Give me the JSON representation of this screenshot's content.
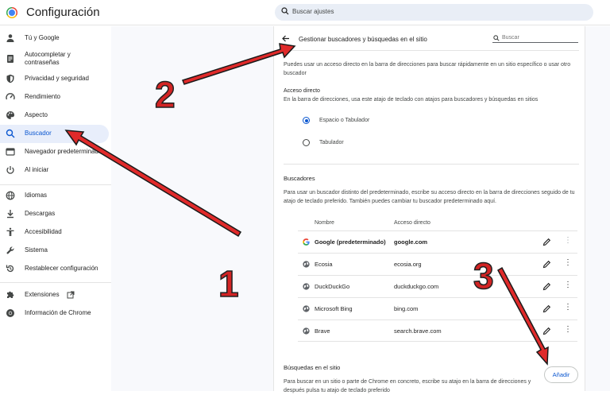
{
  "app": {
    "title": "Configuración",
    "search_placeholder": "Buscar ajustes",
    "accent": "#0b57d0"
  },
  "sidebar": {
    "items": [
      {
        "label": "Tú y Google",
        "icon": "person-icon"
      },
      {
        "label": "Autocompletar y contraseñas",
        "icon": "document-icon"
      },
      {
        "label": "Privacidad y seguridad",
        "icon": "shield-icon"
      },
      {
        "label": "Rendimiento",
        "icon": "gauge-icon"
      },
      {
        "label": "Aspecto",
        "icon": "palette-icon"
      },
      {
        "label": "Buscador",
        "icon": "search-icon",
        "active": true
      },
      {
        "label": "Navegador predeterminado",
        "icon": "browser-icon"
      },
      {
        "label": "Al iniciar",
        "icon": "power-icon"
      },
      {
        "label": "Idiomas",
        "icon": "globe-icon"
      },
      {
        "label": "Descargas",
        "icon": "download-icon"
      },
      {
        "label": "Accesibilidad",
        "icon": "accessibility-icon"
      },
      {
        "label": "Sistema",
        "icon": "wrench-icon"
      },
      {
        "label": "Restablecer configuración",
        "icon": "reset-icon"
      },
      {
        "label": "Extensiones",
        "icon": "puzzle-icon"
      },
      {
        "label": "Información de Chrome",
        "icon": "chrome-icon"
      }
    ]
  },
  "main": {
    "header_title": "Gestionar buscadores y búsquedas en el sitio",
    "search_placeholder": "Buscar",
    "intro": "Puedes usar un acceso directo en la barra de direcciones para buscar rápidamente en un sitio específico o usar otro buscador",
    "shortcut": {
      "title": "Acceso directo",
      "desc": "En la barra de direcciones, usa este atajo de teclado con atajos para buscadores y búsquedas en sitios",
      "options": [
        "Espacio o Tabulador",
        "Tabulador"
      ],
      "selected": 0
    },
    "engines": {
      "title": "Buscadores",
      "desc": "Para usar un buscador distinto del predeterminado, escribe su acceso directo en la barra de direcciones seguido de tu atajo de teclado preferido. También puedes cambiar tu buscador predeterminado aquí.",
      "col_name": "Nombre",
      "col_shortcut": "Acceso directo",
      "rows": [
        {
          "name": "Google (predeterminado)",
          "shortcut": "google.com",
          "icon": "google-icon"
        },
        {
          "name": "Ecosia",
          "shortcut": "ecosia.org",
          "icon": "globe-icon"
        },
        {
          "name": "DuckDuckGo",
          "shortcut": "duckduckgo.com",
          "icon": "globe-icon"
        },
        {
          "name": "Microsoft Bing",
          "shortcut": "bing.com",
          "icon": "globe-icon"
        },
        {
          "name": "Brave",
          "shortcut": "search.brave.com",
          "icon": "globe-icon"
        }
      ]
    },
    "site_search": {
      "title": "Búsquedas en el sitio",
      "desc": "Para buscar en un sitio o parte de Chrome en concreto, escribe su atajo en la barra de direcciones y después pulsa tu atajo de teclado preferido",
      "add_label": "Añadir"
    }
  },
  "annotations": {
    "labels": [
      "1",
      "2",
      "3"
    ],
    "color": "#d32424"
  }
}
